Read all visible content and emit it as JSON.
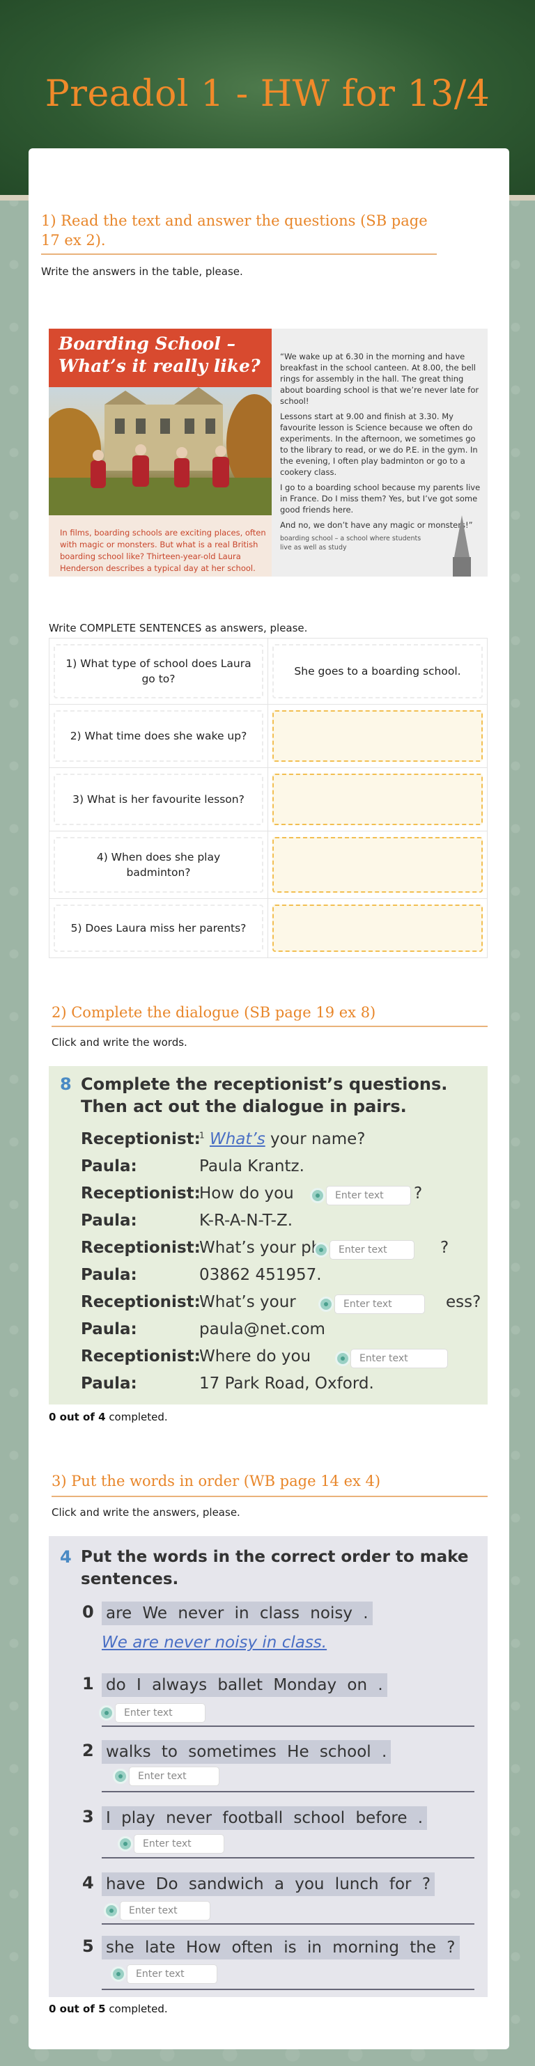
{
  "header": {
    "title": "Preadol 1 - HW for 13/4"
  },
  "section1": {
    "heading": "1) Read the text and answer the questions (SB page 17 ex 2).",
    "instruction": "Write the answers in the table, please.",
    "reading": {
      "title_line1": "Boarding School –",
      "title_line2": "What’s it really like?",
      "caption": "In films, boarding schools are exciting places, often with magic or monsters. But what is a real British boarding school like? Thirteen-year-old Laura Henderson describes a typical day at her school.",
      "paragraphs": [
        "“We wake up at 6.30 in the morning and have breakfast in the school canteen. At 8.00, the bell rings for assembly in the hall. The great thing about boarding school is that we’re never late for school!",
        "Lessons start at 9.00 and finish at 3.30. My favourite lesson is Science because we often do experiments. In the afternoon, we sometimes go to the library to read, or we do P.E. in the gym. In the evening, I often play badminton or go to a cookery class.",
        "I go to a boarding school because my parents live in France. Do I miss them? Yes, but I’ve got some good friends here.",
        "And no, we don’t have any magic or monsters!”"
      ],
      "glossary": "boarding school – a school where students live as well as study"
    },
    "table_instruction": "Write COMPLETE SENTENCES as answers, please.",
    "rows": [
      {
        "question": "1) What type of school does Laura go to?",
        "answer": "She goes to a boarding school."
      },
      {
        "question": "2) What time does she wake up?",
        "answer": ""
      },
      {
        "question": "3) What is her favourite lesson?",
        "answer": ""
      },
      {
        "question": "4) When does she play badminton?",
        "answer": ""
      },
      {
        "question": "5) Does Laura miss her parents?",
        "answer": ""
      }
    ]
  },
  "section2": {
    "heading": "2) Complete the dialogue (SB page 19 ex 8)",
    "instruction": "Click and write the words.",
    "exercise_number": "8",
    "exercise_title_line1": "Complete the receptionist’s questions.",
    "exercise_title_line2": "Then act out the dialogue in pairs.",
    "lines": [
      {
        "speaker": "Receptionist:",
        "text_before": "",
        "sup": "1",
        "example": "What’s",
        "text_after": "your name?"
      },
      {
        "speaker": "Paula:",
        "text_before": "Paula Krantz."
      },
      {
        "speaker": "Receptionist:",
        "text_before": "How do you",
        "sup": "2",
        "text_after": "?"
      },
      {
        "speaker": "Paula:",
        "text_before": "K-R-A-N-T-Z."
      },
      {
        "speaker": "Receptionist:",
        "text_before": "What’s your ph",
        "sup": "3",
        "text_after": "?"
      },
      {
        "speaker": "Paula:",
        "text_before": "03862 451957."
      },
      {
        "speaker": "Receptionist:",
        "text_before": "What’s your",
        "sup": "4",
        "text_after": "ess?"
      },
      {
        "speaker": "Paula:",
        "text_before": "paula@net.com"
      },
      {
        "speaker": "Receptionist:",
        "text_before": "Where do you",
        "sup": "5",
        "text_after": ""
      },
      {
        "speaker": "Paula:",
        "text_before": "17 Park Road, Oxford."
      }
    ],
    "placeholder": "Enter text",
    "progress_count": "0 out of 4",
    "progress_suffix": "completed."
  },
  "section3": {
    "heading": "3) Put the words in order (WB page 14 ex 4)",
    "instruction": "Click and write the answers, please.",
    "exercise_number": "4",
    "exercise_title_line1": "Put the words in the correct order to make",
    "exercise_title_line2": "sentences.",
    "example": {
      "num": "0",
      "words": "are We never in class noisy .",
      "answer": "We are never noisy in class."
    },
    "items": [
      {
        "num": "1",
        "words": "do I always ballet Monday on ."
      },
      {
        "num": "2",
        "words": "walks to sometimes He school ."
      },
      {
        "num": "3",
        "words": "I play never football school before ."
      },
      {
        "num": "4",
        "words": "have Do sandwich a you lunch for ?"
      },
      {
        "num": "5",
        "words": "she late How often is in morning the ?"
      }
    ],
    "placeholder": "Enter text",
    "progress_count": "0 out of 5",
    "progress_suffix": "completed."
  },
  "colors": {
    "accent": "#e8862a",
    "field_border": "#f2bf52",
    "field_bg": "#fdf8e8",
    "dot": "#4aa08e"
  }
}
